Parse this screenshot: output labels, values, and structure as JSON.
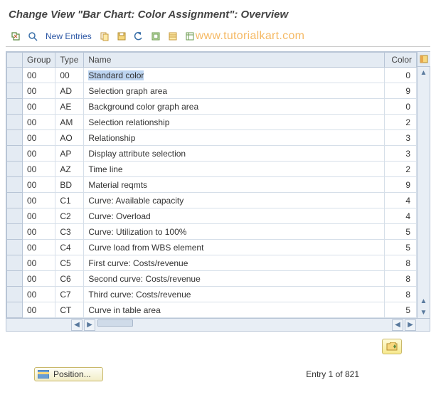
{
  "title": "Change View \"Bar Chart: Color Assignment\": Overview",
  "toolbar": {
    "new_entries": "New Entries"
  },
  "watermark": "www.tutorialkart.com",
  "columns": {
    "group": "Group",
    "type": "Type",
    "name": "Name",
    "color": "Color"
  },
  "rows": [
    {
      "group": "00",
      "type": "00",
      "name": "Standard color",
      "color": "0"
    },
    {
      "group": "00",
      "type": "AD",
      "name": "Selection graph area",
      "color": "9"
    },
    {
      "group": "00",
      "type": "AE",
      "name": "Background color graph area",
      "color": "0"
    },
    {
      "group": "00",
      "type": "AM",
      "name": "Selection relationship",
      "color": "2"
    },
    {
      "group": "00",
      "type": "AO",
      "name": "Relationship",
      "color": "3"
    },
    {
      "group": "00",
      "type": "AP",
      "name": "Display attribute selection",
      "color": "3"
    },
    {
      "group": "00",
      "type": "AZ",
      "name": "Time line",
      "color": "2"
    },
    {
      "group": "00",
      "type": "BD",
      "name": "Material reqmts",
      "color": "9"
    },
    {
      "group": "00",
      "type": "C1",
      "name": "Curve: Available capacity",
      "color": "4"
    },
    {
      "group": "00",
      "type": "C2",
      "name": "Curve: Overload",
      "color": "4"
    },
    {
      "group": "00",
      "type": "C3",
      "name": "Curve: Utilization to 100%",
      "color": "5"
    },
    {
      "group": "00",
      "type": "C4",
      "name": "Curve load from WBS element",
      "color": "5"
    },
    {
      "group": "00",
      "type": "C5",
      "name": "First curve: Costs/revenue",
      "color": "8"
    },
    {
      "group": "00",
      "type": "C6",
      "name": "Second curve: Costs/revenue",
      "color": "8"
    },
    {
      "group": "00",
      "type": "C7",
      "name": "Third curve: Costs/revenue",
      "color": "8"
    },
    {
      "group": "00",
      "type": "CT",
      "name": "Curve in table area",
      "color": "5"
    }
  ],
  "position_button": "Position...",
  "entry_status": "Entry 1 of 821"
}
